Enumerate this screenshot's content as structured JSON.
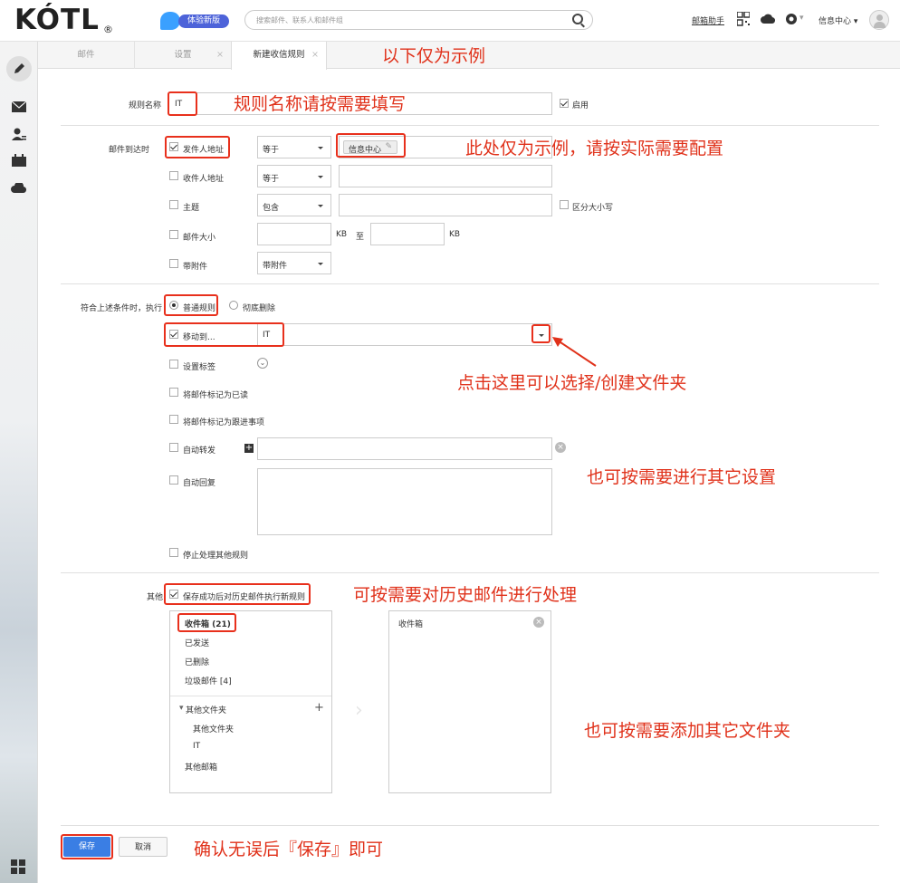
{
  "brand": {
    "logo": "KÓTL",
    "reg": "®",
    "experience_badge": "体验新版"
  },
  "search": {
    "placeholder": "搜索邮件、联系人和邮件组"
  },
  "top_links": {
    "assistant": "邮箱助手",
    "info_center": "信息中心 ▾"
  },
  "tabs": [
    {
      "label": "邮件"
    },
    {
      "label": "设置"
    },
    {
      "label": "新建收信规则"
    }
  ],
  "annotations": {
    "example_only": "以下仅为示例",
    "rule_name_hint": "规则名称请按需要填写",
    "config_hint": "此处仅为示例，请按实际需要配置",
    "folder_hint": "点击这里可以选择/创建文件夹",
    "other_settings_hint": "也可按需要进行其它设置",
    "history_hint": "可按需要对历史邮件进行处理",
    "add_folder_hint": "也可按需要添加其它文件夹",
    "save_hint": "确认无误后『保存』即可"
  },
  "rule": {
    "name_label": "规则名称",
    "name_value": "IT",
    "enable_label": "启用",
    "when_arrive_label": "邮件到达时",
    "conditions": [
      {
        "label": "发件人地址",
        "checked": true,
        "op": "等于",
        "value_tag": "信息中心"
      },
      {
        "label": "收件人地址",
        "checked": false,
        "op": "等于"
      },
      {
        "label": "主题",
        "checked": false,
        "op": "包含",
        "extra": "区分大小写"
      },
      {
        "label": "邮件大小",
        "checked": false,
        "unit1": "KB",
        "to": "至",
        "unit2": "KB"
      },
      {
        "label": "带附件",
        "checked": false,
        "op": "带附件"
      }
    ],
    "execute_label": "符合上述条件时，执行",
    "mode_normal": "普通规则",
    "mode_delete": "彻底删除",
    "actions": {
      "move_to": "移动到...",
      "move_value": "IT",
      "set_tag": "设置标签",
      "mark_read": "将邮件标记为已读",
      "mark_followup": "将邮件标记为跟进事项",
      "auto_forward": "自动转发",
      "auto_reply": "自动回复",
      "stop_processing": "停止处理其他规则"
    },
    "other_label": "其他",
    "apply_history": "保存成功后对历史邮件执行新规则"
  },
  "folders": {
    "left": [
      "收件箱 (21)",
      "已发送",
      "已删除",
      "垃圾邮件 [4]"
    ],
    "other_group": "其他文件夹",
    "other_children": [
      "其他文件夹",
      "IT"
    ],
    "other_mailboxes": "其他邮箱",
    "right": [
      "收件箱"
    ]
  },
  "buttons": {
    "save": "保存",
    "cancel": "取消"
  }
}
